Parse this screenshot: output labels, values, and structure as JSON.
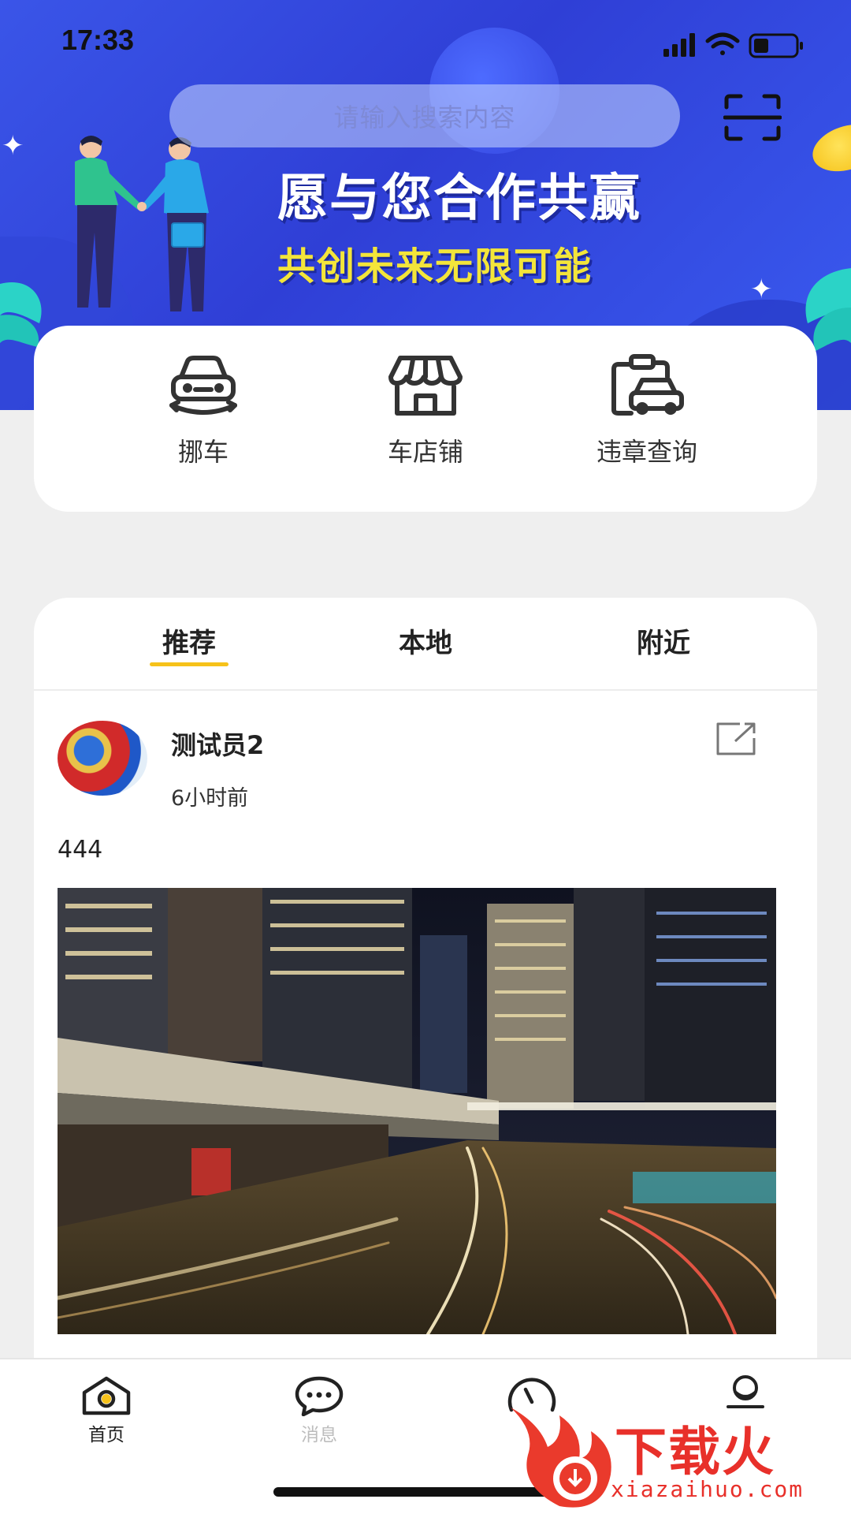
{
  "status_bar": {
    "time": "17:33"
  },
  "search": {
    "placeholder": "请输入搜索内容"
  },
  "banner": {
    "slogan_main": "愿与您合作共赢",
    "slogan_sub": "共创未来无限可能"
  },
  "quick_actions": [
    {
      "label": "挪车",
      "icon": "car-move-icon"
    },
    {
      "label": "车店铺",
      "icon": "store-icon"
    },
    {
      "label": "违章查询",
      "icon": "violation-query-icon"
    }
  ],
  "feed": {
    "tabs": [
      {
        "label": "推荐",
        "active": true
      },
      {
        "label": "本地",
        "active": false
      },
      {
        "label": "附近",
        "active": false
      }
    ],
    "post": {
      "username": "测试员2",
      "time_ago": "6小时前",
      "text": "444"
    }
  },
  "tabbar": {
    "items": [
      {
        "label": "首页",
        "active": true,
        "icon": "home-icon"
      },
      {
        "label": "消息",
        "active": false,
        "icon": "message-icon"
      },
      {
        "label": "",
        "active": false,
        "icon": "discover-icon"
      },
      {
        "label": "",
        "active": false,
        "icon": "profile-icon"
      }
    ]
  },
  "watermark": {
    "text": "下载火",
    "url": "xiazaihuo.com"
  },
  "colors": {
    "accent": "#f6c21a",
    "banner_blue": "#3347e0",
    "slogan_yellow": "#f3e53a"
  }
}
